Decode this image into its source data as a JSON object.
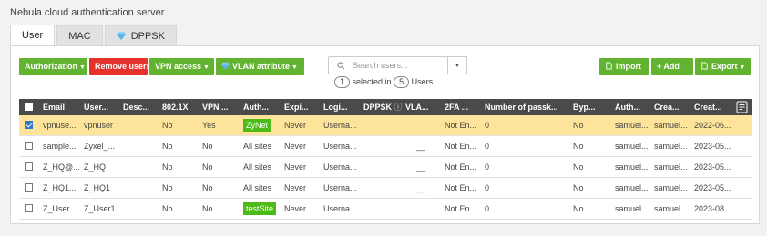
{
  "page": {
    "title": "Nebula cloud authentication server"
  },
  "tabs": [
    {
      "label": "User",
      "active": true
    },
    {
      "label": "MAC",
      "active": false
    },
    {
      "label": "DPPSK",
      "active": false,
      "icon": "diamond-icon"
    }
  ],
  "toolbar": {
    "authorization": "Authorization",
    "remove_users": "Remove users",
    "vpn_access": "VPN access",
    "vlan_attribute": "VLAN attribute",
    "import": "Import",
    "add": "+ Add",
    "export": "Export"
  },
  "search": {
    "placeholder": "Search users...",
    "selected_count": "1",
    "selected_text": "selected in",
    "total_count": "5",
    "users_text": "Users"
  },
  "table": {
    "headers": {
      "email": "Email",
      "username": "User...",
      "description": "Desc...",
      "dot1x": "802.1X",
      "vpn": "VPN ...",
      "auth": "Auth...",
      "expiry": "Expi...",
      "login": "Logi...",
      "dppsk": "DPPSK",
      "vlan": "VLA...",
      "twofa": "2FA ...",
      "passkeys": "Number of passk...",
      "bypass": "Byp...",
      "authby": "Auth...",
      "createdby": "Crea...",
      "created": "Creat..."
    },
    "rows": [
      {
        "selected": true,
        "email": "vpnuse...",
        "username": "vpnuser",
        "description": "",
        "dot1x": "No",
        "vpn": "Yes",
        "auth": "ZyNet",
        "auth_badge": true,
        "expiry": "Never",
        "login": "Userna...",
        "vlan": "",
        "twofa": "Not En...",
        "passkeys": "0",
        "bypass": "No",
        "authby": "samuel...",
        "createdby": "samuel...",
        "created": "2022-06..."
      },
      {
        "selected": false,
        "email": "sample...",
        "username": "Zyxel_...",
        "description": "",
        "dot1x": "No",
        "vpn": "No",
        "auth": "All sites",
        "auth_badge": false,
        "expiry": "Never",
        "login": "Userna...",
        "vlan": "__",
        "twofa": "Not En...",
        "passkeys": "0",
        "bypass": "No",
        "authby": "samuel...",
        "createdby": "samuel...",
        "created": "2023-05..."
      },
      {
        "selected": false,
        "email": "Z_HQ@...",
        "username": "Z_HQ",
        "description": "",
        "dot1x": "No",
        "vpn": "No",
        "auth": "All sites",
        "auth_badge": false,
        "expiry": "Never",
        "login": "Userna...",
        "vlan": "__",
        "twofa": "Not En...",
        "passkeys": "0",
        "bypass": "No",
        "authby": "samuel...",
        "createdby": "samuel...",
        "created": "2023-05..."
      },
      {
        "selected": false,
        "email": "Z_HQ1...",
        "username": "Z_HQ1",
        "description": "",
        "dot1x": "No",
        "vpn": "No",
        "auth": "All sites",
        "auth_badge": false,
        "expiry": "Never",
        "login": "Userna...",
        "vlan": "__",
        "twofa": "Not En...",
        "passkeys": "0",
        "bypass": "No",
        "authby": "samuel...",
        "createdby": "samuel...",
        "created": "2023-05..."
      },
      {
        "selected": false,
        "email": "Z_User...",
        "username": "Z_User1",
        "description": "",
        "dot1x": "No",
        "vpn": "No",
        "auth": "testSite",
        "auth_badge": true,
        "expiry": "Never",
        "login": "Userna...",
        "vlan": "",
        "twofa": "Not En...",
        "passkeys": "0",
        "bypass": "No",
        "authby": "samuel...",
        "createdby": "samuel...",
        "created": "2023-08..."
      }
    ]
  },
  "colors": {
    "green": "#62b32f",
    "red": "#e5322d",
    "header": "#4a4a4a",
    "selected_row": "#fde49a",
    "badge": "#4cbb17"
  }
}
